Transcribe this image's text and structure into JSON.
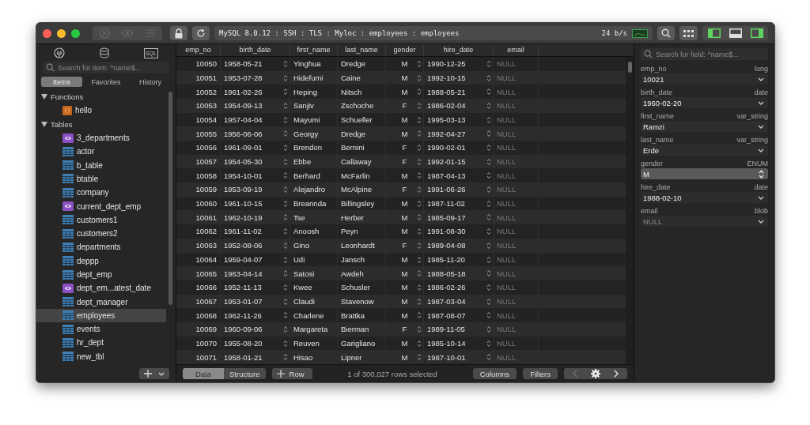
{
  "toolbar": {
    "breadcrumb": "MySQL 8.0.12 : SSH : TLS : Myloc : employees : employees",
    "rate": "24 b/s",
    "panels": [
      {
        "kind": "left",
        "on": true
      },
      {
        "kind": "bottom",
        "on": false
      },
      {
        "kind": "right",
        "on": true
      }
    ]
  },
  "sidebar": {
    "sql_label": "SQL",
    "search": {
      "placeholder": "Search for item: ^name$..."
    },
    "tabs": [
      {
        "label": "Items",
        "selected": true
      },
      {
        "label": "Favorites",
        "selected": false
      },
      {
        "label": "History",
        "selected": false
      }
    ],
    "groups": [
      {
        "label": "Functions",
        "expanded": true,
        "items": [
          {
            "name": "hello",
            "kind": "function",
            "selected": false
          }
        ]
      },
      {
        "label": "Tables",
        "expanded": true,
        "items": [
          {
            "name": "3_departments",
            "kind": "view",
            "selected": false
          },
          {
            "name": "actor",
            "kind": "table",
            "selected": false
          },
          {
            "name": "b_table",
            "kind": "table",
            "selected": false
          },
          {
            "name": "btable",
            "kind": "table",
            "selected": false
          },
          {
            "name": "company",
            "kind": "table",
            "selected": false
          },
          {
            "name": "current_dept_emp",
            "kind": "view",
            "selected": false
          },
          {
            "name": "customers1",
            "kind": "table",
            "selected": false
          },
          {
            "name": "customers2",
            "kind": "table",
            "selected": false
          },
          {
            "name": "departments",
            "kind": "table",
            "selected": false
          },
          {
            "name": "deppp",
            "kind": "table",
            "selected": false
          },
          {
            "name": "dept_emp",
            "kind": "table",
            "selected": false
          },
          {
            "name": "dept_em...atest_date",
            "kind": "view",
            "selected": false
          },
          {
            "name": "dept_manager",
            "kind": "table",
            "selected": false
          },
          {
            "name": "employees",
            "kind": "table",
            "selected": true
          },
          {
            "name": "events",
            "kind": "table",
            "selected": false
          },
          {
            "name": "hr_dept",
            "kind": "table",
            "selected": false
          },
          {
            "name": "new_tbl",
            "kind": "table",
            "selected": false
          }
        ]
      }
    ]
  },
  "table": {
    "columns": [
      "emp_no",
      "birth_date",
      "first_name",
      "last_name",
      "gender",
      "hire_date",
      "email"
    ],
    "rows": [
      [
        "10050",
        "1958-05-21",
        "Yinghua",
        "Dredge",
        "M",
        "1990-12-25",
        "NULL"
      ],
      [
        "10051",
        "1953-07-28",
        "Hidefumi",
        "Caine",
        "M",
        "1992-10-15",
        "NULL"
      ],
      [
        "10052",
        "1961-02-26",
        "Heping",
        "Nitsch",
        "M",
        "1988-05-21",
        "NULL"
      ],
      [
        "10053",
        "1954-09-13",
        "Sanjiv",
        "Zschoche",
        "F",
        "1986-02-04",
        "NULL"
      ],
      [
        "10054",
        "1957-04-04",
        "Mayumi",
        "Schueller",
        "M",
        "1995-03-13",
        "NULL"
      ],
      [
        "10055",
        "1956-06-06",
        "Georgy",
        "Dredge",
        "M",
        "1992-04-27",
        "NULL"
      ],
      [
        "10056",
        "1961-09-01",
        "Brendon",
        "Bernini",
        "F",
        "1990-02-01",
        "NULL"
      ],
      [
        "10057",
        "1954-05-30",
        "Ebbe",
        "Callaway",
        "F",
        "1992-01-15",
        "NULL"
      ],
      [
        "10058",
        "1954-10-01",
        "Berhard",
        "McFarlin",
        "M",
        "1987-04-13",
        "NULL"
      ],
      [
        "10059",
        "1953-09-19",
        "Alejandro",
        "McAlpine",
        "F",
        "1991-06-26",
        "NULL"
      ],
      [
        "10060",
        "1961-10-15",
        "Breannda",
        "Billingsley",
        "M",
        "1987-11-02",
        "NULL"
      ],
      [
        "10061",
        "1962-10-19",
        "Tse",
        "Herber",
        "M",
        "1985-09-17",
        "NULL"
      ],
      [
        "10062",
        "1961-11-02",
        "Anoosh",
        "Peyn",
        "M",
        "1991-08-30",
        "NULL"
      ],
      [
        "10063",
        "1952-08-06",
        "Gino",
        "Leonhardt",
        "F",
        "1989-04-08",
        "NULL"
      ],
      [
        "10064",
        "1959-04-07",
        "Udi",
        "Jansch",
        "M",
        "1985-11-20",
        "NULL"
      ],
      [
        "10065",
        "1963-04-14",
        "Satosi",
        "Awdeh",
        "M",
        "1988-05-18",
        "NULL"
      ],
      [
        "10066",
        "1952-11-13",
        "Kwee",
        "Schusler",
        "M",
        "1986-02-26",
        "NULL"
      ],
      [
        "10067",
        "1953-01-07",
        "Claudi",
        "Stavenow",
        "M",
        "1987-03-04",
        "NULL"
      ],
      [
        "10068",
        "1962-11-26",
        "Charlene",
        "Brattka",
        "M",
        "1987-08-07",
        "NULL"
      ],
      [
        "10069",
        "1960-09-06",
        "Margareta",
        "Bierman",
        "F",
        "1989-11-05",
        "NULL"
      ],
      [
        "10070",
        "1955-08-20",
        "Reuven",
        "Garigliano",
        "M",
        "1985-10-14",
        "NULL"
      ],
      [
        "10071",
        "1958-01-21",
        "Hisao",
        "Lipner",
        "M",
        "1987-10-01",
        "NULL"
      ]
    ]
  },
  "bottom_bar": {
    "tabs": [
      {
        "label": "Data",
        "selected": true
      },
      {
        "label": "Structure",
        "selected": false
      }
    ],
    "add_row": "Row",
    "status": "1 of 300,027 rows selected",
    "buttons": [
      "Columns",
      "Filters"
    ]
  },
  "inspector": {
    "search": {
      "placeholder": "Search for field: ^name$..."
    },
    "fields": [
      {
        "name": "emp_no",
        "type": "long",
        "value": "10021",
        "kind": "dropdown",
        "is_null": false
      },
      {
        "name": "birth_date",
        "type": "date",
        "value": "1960-02-20",
        "kind": "dropdown",
        "is_null": false
      },
      {
        "name": "first_name",
        "type": "var_string",
        "value": "Ramzi",
        "kind": "dropdown",
        "is_null": false
      },
      {
        "name": "last_name",
        "type": "var_string",
        "value": "Erde",
        "kind": "dropdown",
        "is_null": false
      },
      {
        "name": "gender",
        "type": "ENUM",
        "value": "M",
        "kind": "select",
        "is_null": false
      },
      {
        "name": "hire_date",
        "type": "date",
        "value": "1988-02-10",
        "kind": "dropdown",
        "is_null": false
      },
      {
        "name": "email",
        "type": "blob",
        "value": "NULL",
        "kind": "dropdown",
        "is_null": true
      }
    ]
  }
}
